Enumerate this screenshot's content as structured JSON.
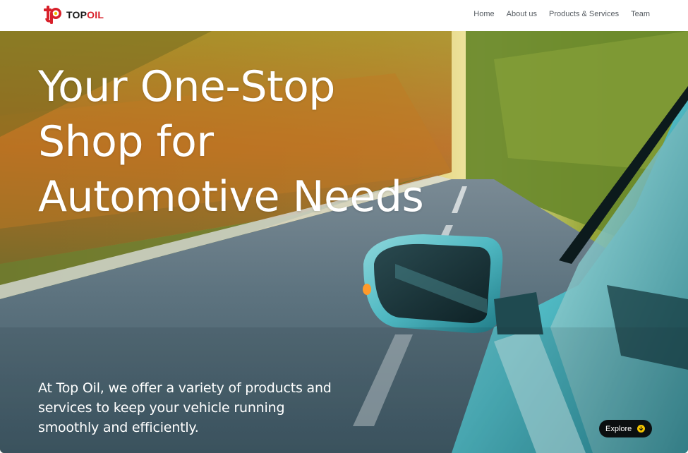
{
  "brand": {
    "name_top": "TOP",
    "name_oil": "OIL",
    "logo_icon": "topoil-logo-icon",
    "brand_color": "#d8202a"
  },
  "nav": {
    "items": [
      {
        "label": "Home"
      },
      {
        "label": "About us"
      },
      {
        "label": "Products & Services"
      },
      {
        "label": "Team"
      }
    ]
  },
  "hero": {
    "headline_lines": [
      "Your One-Stop",
      "Shop for",
      "Automotive Needs"
    ],
    "subtext": "At Top Oil, we offer a variety of products and services to keep your vehicle running smoothly and efficiently.",
    "image_description_icon": "road-car-mirror-image",
    "cta": {
      "label": "Explore",
      "icon": "arrow-down-icon",
      "accent": "#f2c400"
    }
  }
}
